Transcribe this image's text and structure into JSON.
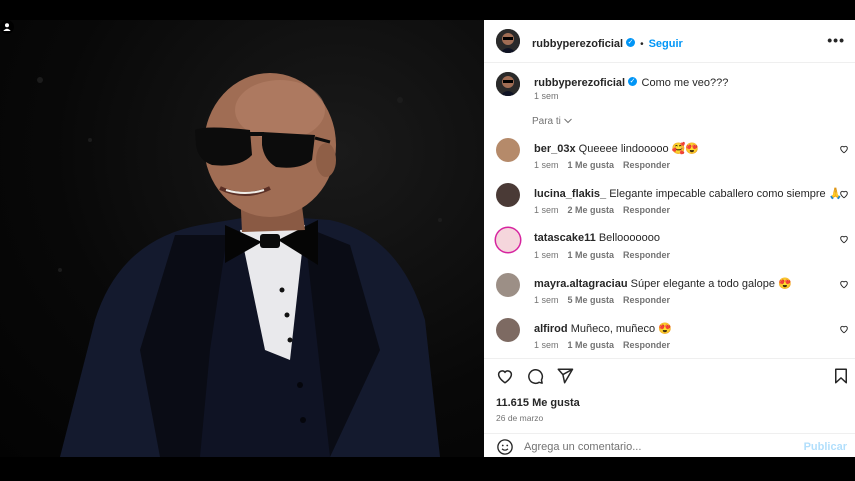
{
  "post": {
    "username": "rubbyperezoficial",
    "follow_label": "Seguir",
    "separator": "•",
    "more_label": "•••",
    "caption": "Como me veo???",
    "caption_time": "1 sem",
    "sort_label": "Para ti"
  },
  "comments": [
    {
      "user": "ber_03x",
      "text": "Queeee lindooooo 🥰😍",
      "time": "1 sem",
      "likes": "1 Me gusta",
      "reply": "Responder"
    },
    {
      "user": "lucina_flakis_",
      "text": "Elegante impecable caballero como siempre 🙏",
      "time": "1 sem",
      "likes": "2 Me gusta",
      "reply": "Responder"
    },
    {
      "user": "tatascake11",
      "text": "Bellooooooo",
      "time": "1 sem",
      "likes": "1 Me gusta",
      "reply": "Responder"
    },
    {
      "user": "mayra.altagraciau",
      "text": "Súper elegante a todo galope 😍",
      "time": "1 sem",
      "likes": "5 Me gusta",
      "reply": "Responder"
    },
    {
      "user": "alfirod",
      "text": "Muñeco, muñeco 😍",
      "time": "1 sem",
      "likes": "1 Me gusta",
      "reply": "Responder"
    }
  ],
  "footer": {
    "likes": "11.615 Me gusta",
    "date": "26 de marzo",
    "comment_placeholder": "Agrega un comentario...",
    "publish_label": "Publicar"
  },
  "icons": {
    "verified": "verified-badge-icon",
    "like": "heart-icon",
    "comment": "comment-icon",
    "share": "share-icon",
    "save": "bookmark-icon",
    "emoji": "emoji-icon",
    "more": "more-options-icon",
    "user_tag": "user-tag-icon"
  },
  "colors": {
    "accent": "#0095f6",
    "secondary_text": "#737373",
    "publish_disabled": "#b2dffc"
  }
}
